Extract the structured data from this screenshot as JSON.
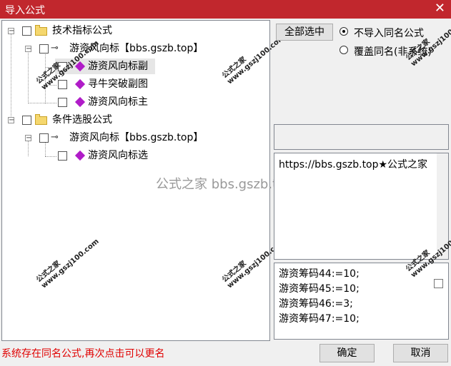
{
  "window": {
    "title": "导入公式",
    "close_glyph": "✕"
  },
  "tree": {
    "group1": {
      "label": "技术指标公式"
    },
    "group1_child": {
      "label": "游资风向标【bbs.gszb.top】"
    },
    "group1_items": [
      "游资风向标副",
      "寻牛突破副图",
      "游资风向标主"
    ],
    "group2": {
      "label": "条件选股公式"
    },
    "group2_child": {
      "label": "游资风向标【bbs.gszb.top】"
    },
    "group2_items": [
      "游资风向标选"
    ]
  },
  "watermarks": {
    "site": "公式之家",
    "url": "www.gszj100.com",
    "center": "公式之家 bbs.gszb.top"
  },
  "actions": {
    "select_all": "全部选中",
    "no_import_same": "不导入同名公式",
    "overwrite_same": "覆盖同名(非系统)"
  },
  "description": {
    "text": "https://bbs.gszb.top★公式之家"
  },
  "code": {
    "lines": [
      "游资筹码44:=10;",
      "游资筹码45:=10;",
      "游资筹码46:=3;",
      "游资筹码47:=10;"
    ]
  },
  "status": {
    "text": "系统存在同名公式,再次点击可以更名"
  },
  "footer": {
    "ok": "确定",
    "cancel": "取消"
  }
}
